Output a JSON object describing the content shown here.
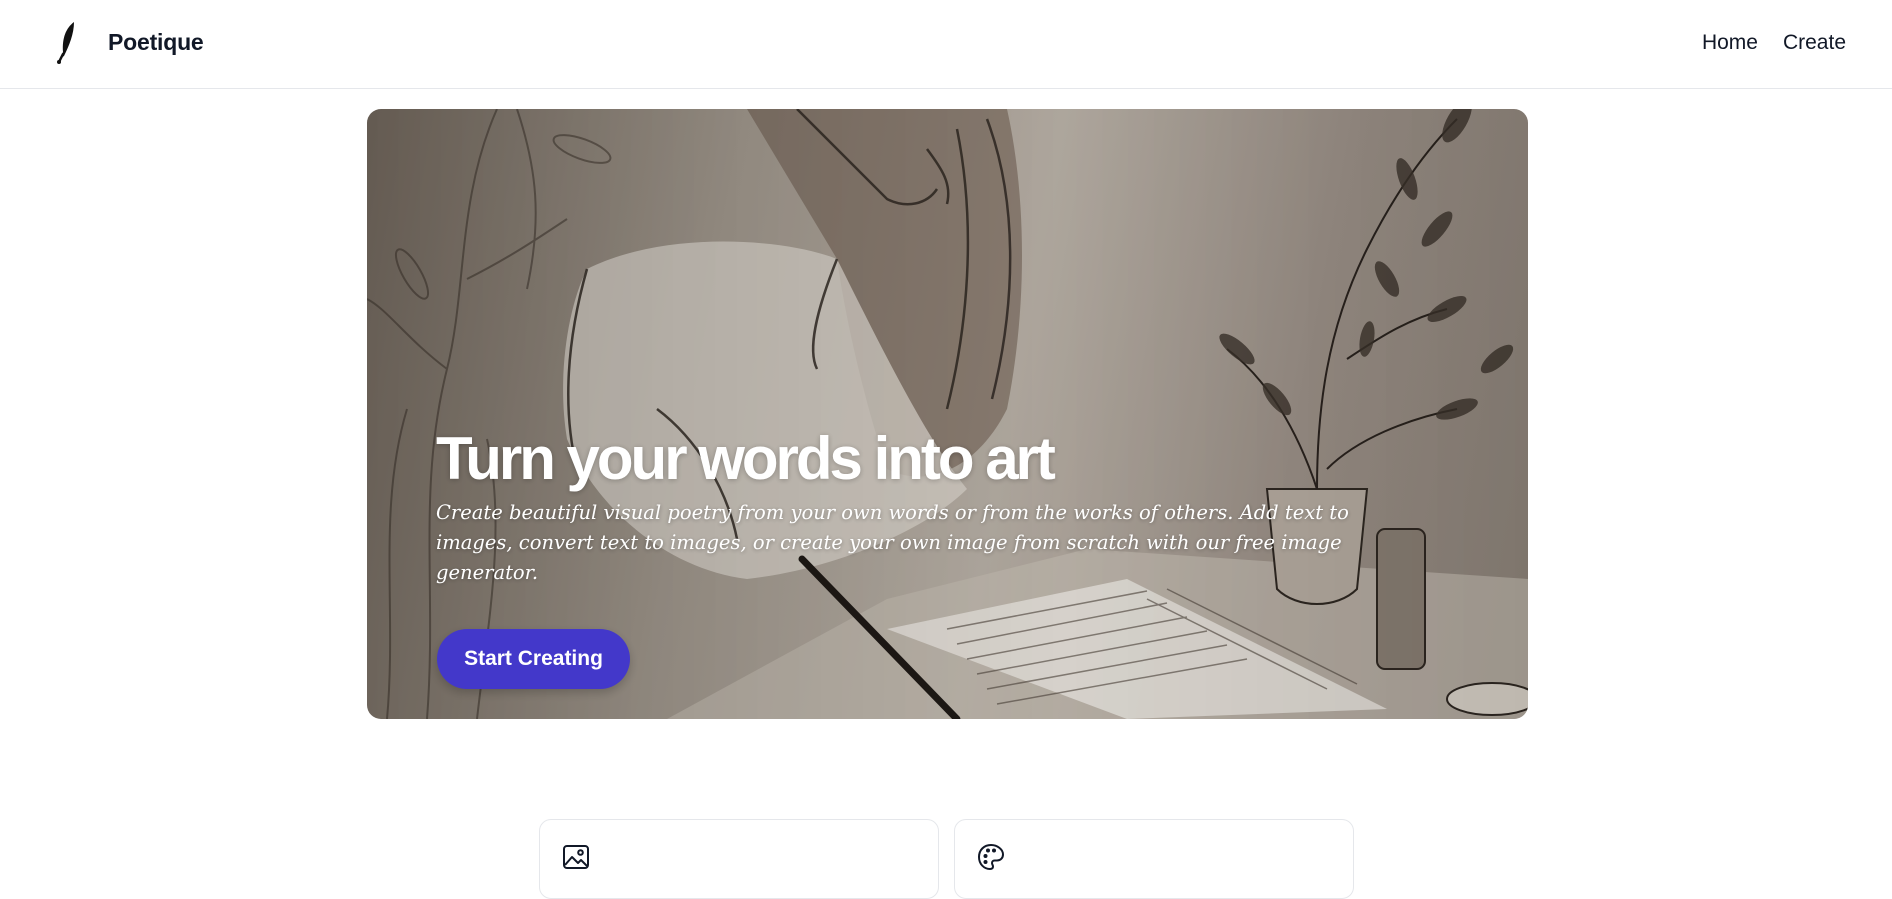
{
  "header": {
    "brand_name": "Poetique",
    "logo_icon": "quill-pen-icon",
    "nav": [
      {
        "label": "Home"
      },
      {
        "label": "Create"
      }
    ]
  },
  "hero": {
    "title": "Turn your words into art",
    "subtitle": "Create beautiful visual poetry from your own words or from the works of others. Add text to images, convert text to images, or create your own image from scratch with our free image generator.",
    "cta_label": "Start Creating",
    "accent_color": "#4338ca"
  },
  "features": [
    {
      "icon": "image-icon"
    },
    {
      "icon": "palette-icon"
    }
  ]
}
